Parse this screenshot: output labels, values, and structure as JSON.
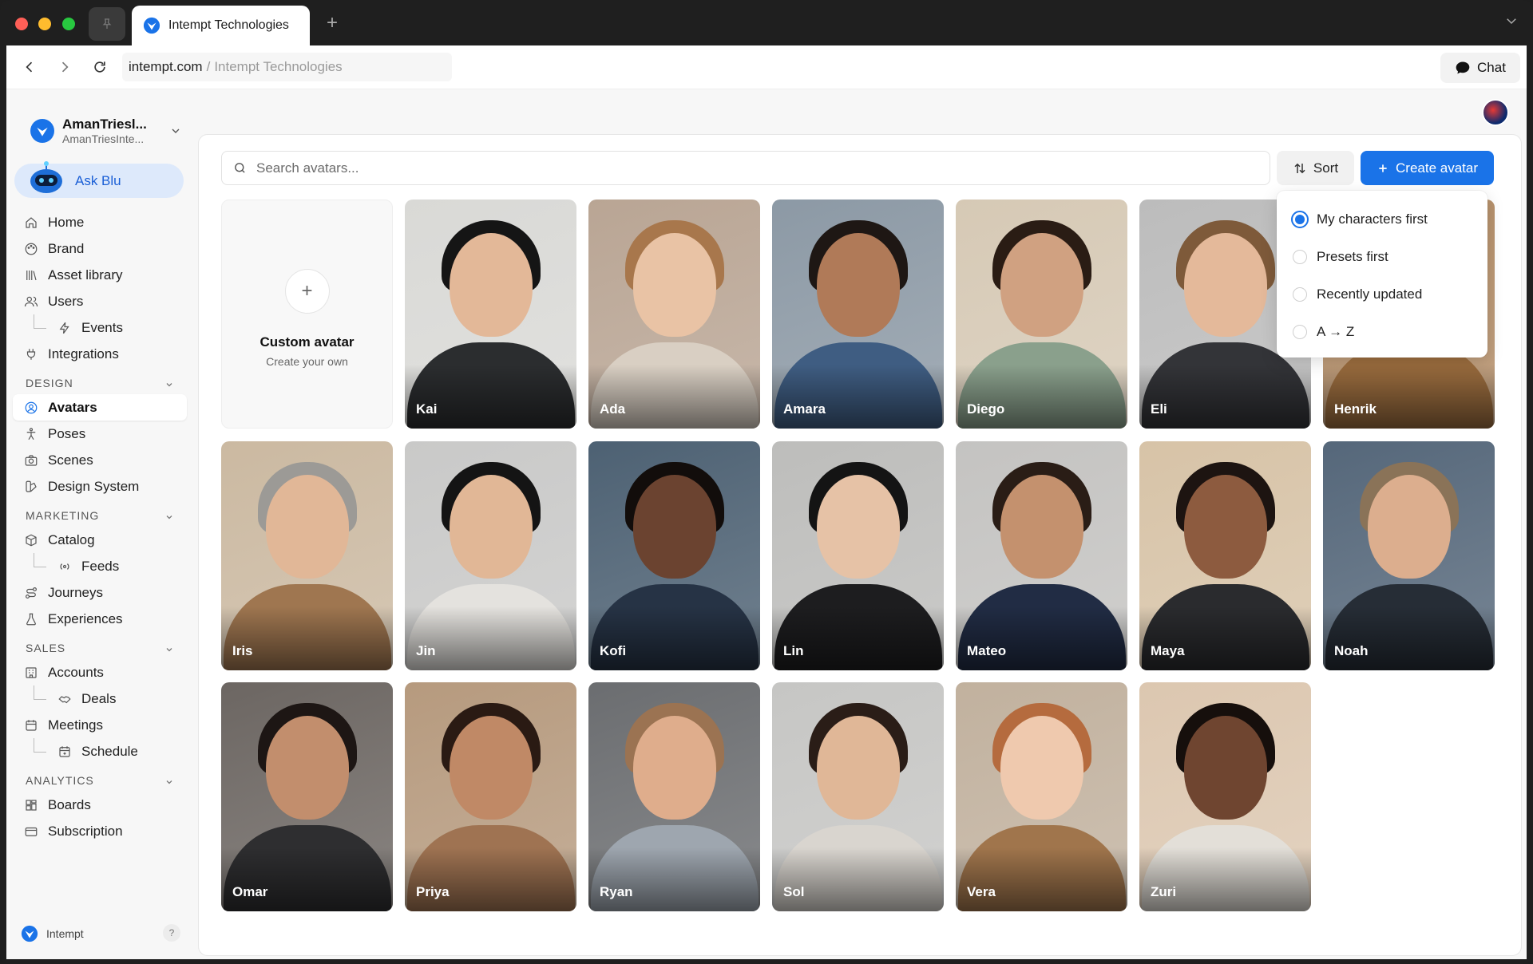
{
  "browser": {
    "tab_title": "Intempt Technologies",
    "url_host": "intempt.com",
    "url_separator": "/",
    "url_page": "Intempt Technologies",
    "chat_label": "Chat"
  },
  "sidebar": {
    "org_name": "AmanTriesl...",
    "org_sub": "AmanTriesInte...",
    "ask_blu": "Ask Blu",
    "items_top": [
      {
        "label": "Home",
        "icon": "home-icon"
      },
      {
        "label": "Brand",
        "icon": "palette-icon"
      },
      {
        "label": "Asset library",
        "icon": "library-icon"
      },
      {
        "label": "Users",
        "icon": "users-icon"
      },
      {
        "label": "Events",
        "icon": "bolt-icon",
        "sub": true
      },
      {
        "label": "Integrations",
        "icon": "plug-icon"
      }
    ],
    "sections": {
      "design": "DESIGN",
      "marketing": "MARKETING",
      "sales": "SALES",
      "analytics": "ANALYTICS"
    },
    "design_items": [
      {
        "label": "Avatars",
        "icon": "avatar-icon",
        "active": true
      },
      {
        "label": "Poses",
        "icon": "pose-icon"
      },
      {
        "label": "Scenes",
        "icon": "camera-icon"
      },
      {
        "label": "Design System",
        "icon": "design-system-icon"
      }
    ],
    "marketing_items": [
      {
        "label": "Catalog",
        "icon": "box-icon"
      },
      {
        "label": "Feeds",
        "icon": "broadcast-icon",
        "sub": true
      },
      {
        "label": "Journeys",
        "icon": "route-icon"
      },
      {
        "label": "Experiences",
        "icon": "flask-icon"
      }
    ],
    "sales_items": [
      {
        "label": "Accounts",
        "icon": "building-icon"
      },
      {
        "label": "Deals",
        "icon": "handshake-icon",
        "sub": true
      },
      {
        "label": "Meetings",
        "icon": "calendar-icon"
      },
      {
        "label": "Schedule",
        "icon": "calendar-plus-icon",
        "sub": true
      }
    ],
    "analytics_items": [
      {
        "label": "Boards",
        "icon": "grid-icon"
      },
      {
        "label": "Subscription",
        "icon": "card-icon"
      }
    ],
    "footer_brand": "Intempt",
    "help": "?"
  },
  "main": {
    "search_placeholder": "Search avatars...",
    "sort_label": "Sort",
    "create_label": "Create avatar",
    "custom_card": {
      "title": "Custom avatar",
      "subtitle": "Create your own"
    },
    "sort_options": [
      {
        "label": "My characters first",
        "selected": true
      },
      {
        "label": "Presets first",
        "selected": false
      },
      {
        "label": "Recently updated",
        "selected": false
      },
      {
        "label": "A → Z",
        "selected": false
      }
    ],
    "avatars": [
      {
        "name": "Kai",
        "bg": "#d9d9d6",
        "hair": "#151515",
        "skin": "#e3b898",
        "shirt": "#2b2d2f"
      },
      {
        "name": "Ada",
        "bg": "#b9a594",
        "hair": "#a8774c",
        "skin": "#e9c3a5",
        "shirt": "#d9cfc3"
      },
      {
        "name": "Amara",
        "bg": "#8c99a5",
        "hair": "#1e1714",
        "skin": "#b07a58",
        "shirt": "#3f5d82"
      },
      {
        "name": "Diego",
        "bg": "#d6c9b5",
        "hair": "#2a1c14",
        "skin": "#d0a181",
        "shirt": "#8aa08c"
      },
      {
        "name": "Eli",
        "bg": "#bcbcbc",
        "hair": "#7e5a3a",
        "skin": "#e4b99a",
        "shirt": "#333438"
      },
      {
        "name": "Henrik",
        "bg": "#b48d66",
        "hair": "#7b6552",
        "skin": "#d8ae8c",
        "shirt": "#9a6c3e"
      },
      {
        "name": "Iris",
        "bg": "#cbb9a1",
        "hair": "#9c9a96",
        "skin": "#e1b797",
        "shirt": "#9f7650"
      },
      {
        "name": "Jin",
        "bg": "#c9c9c8",
        "hair": "#141414",
        "skin": "#e1b796",
        "shirt": "#e4e2de"
      },
      {
        "name": "Kofi",
        "bg": "#4d6173",
        "hair": "#120d0b",
        "skin": "#6b4330",
        "shirt": "#263345"
      },
      {
        "name": "Lin",
        "bg": "#bdbdbb",
        "hair": "#141414",
        "skin": "#e6c2a6",
        "shirt": "#1d1d1f"
      },
      {
        "name": "Mateo",
        "bg": "#c4c3c1",
        "hair": "#2a1d16",
        "skin": "#c4916e",
        "shirt": "#212c44"
      },
      {
        "name": "Maya",
        "bg": "#d7c3a7",
        "hair": "#1d1411",
        "skin": "#8d5b3f",
        "shirt": "#2a2b2e"
      },
      {
        "name": "Noah",
        "bg": "#55677a",
        "hair": "#8a7358",
        "skin": "#dcae8e",
        "shirt": "#262d36"
      },
      {
        "name": "Omar",
        "bg": "#6c6662",
        "hair": "#1d1614",
        "skin": "#c28e6d",
        "shirt": "#2e2e30"
      },
      {
        "name": "Priya",
        "bg": "#b69a7e",
        "hair": "#2a1a13",
        "skin": "#c08966",
        "shirt": "#9f7352"
      },
      {
        "name": "Ryan",
        "bg": "#6b6d70",
        "hair": "#9b7352",
        "skin": "#dfad8c",
        "shirt": "#9ea6af"
      },
      {
        "name": "Sol",
        "bg": "#c6c6c4",
        "hair": "#2a1d17",
        "skin": "#e0b797",
        "shirt": "#d9d5cf"
      },
      {
        "name": "Vera",
        "bg": "#c1b19e",
        "hair": "#b56b3e",
        "skin": "#efc9ae",
        "shirt": "#a0754c"
      },
      {
        "name": "Zuri",
        "bg": "#dcc7b0",
        "hair": "#160f0c",
        "skin": "#6f4530",
        "shirt": "#e3dfd8"
      }
    ]
  },
  "colors": {
    "accent": "#1a73e8",
    "ask_blu_bg": "#dde9fb"
  }
}
